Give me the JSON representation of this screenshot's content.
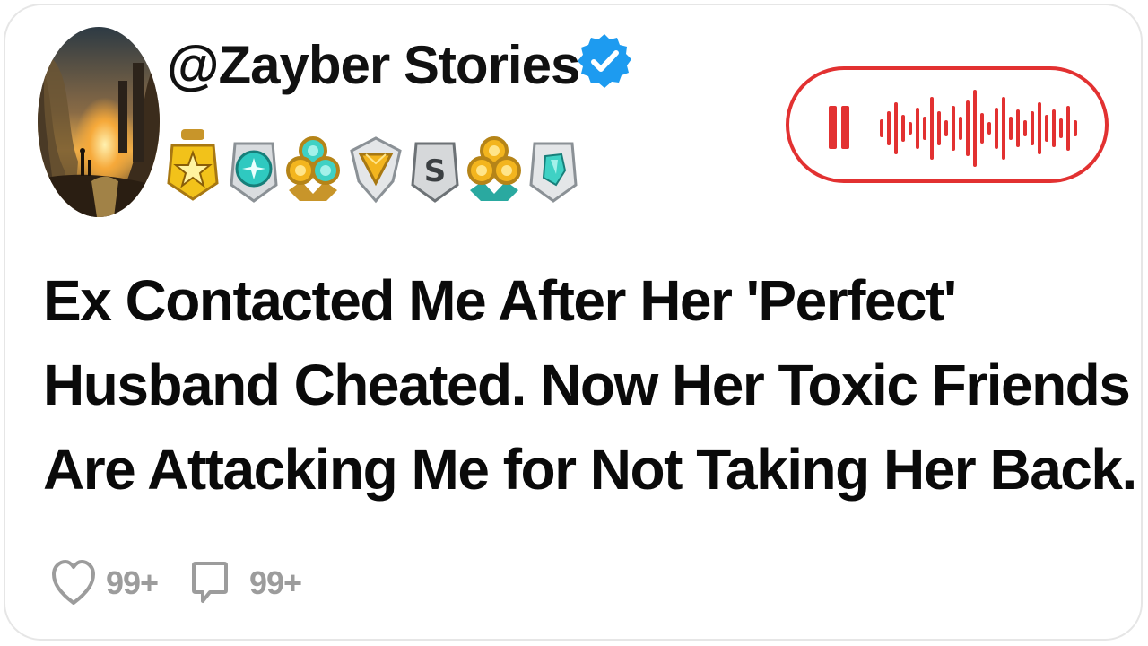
{
  "post": {
    "username": "@Zayber Stories",
    "verified": true,
    "title_lines": [
      "Ex Contacted Me After Her 'Perfect'",
      "Husband Cheated. Now Her Toxic Friends",
      "Are Attacking Me for Not Taking Her Back."
    ],
    "likes": "99+",
    "comments": "99+"
  },
  "badges": [
    {
      "name": "gold-star-badge-icon"
    },
    {
      "name": "silver-diamond-badge-icon"
    },
    {
      "name": "gold-trio-gem-badge-icon"
    },
    {
      "name": "silver-gold-gem-badge-icon"
    },
    {
      "name": "silver-s-badge-icon"
    },
    {
      "name": "gold-trio-gem-badge-icon-2"
    },
    {
      "name": "silver-crystal-badge-icon"
    }
  ],
  "colors": {
    "accent_red": "#e23131",
    "verified_blue": "#1d9bf0",
    "text": "#0a0a0a",
    "muted": "#9c9c9c"
  }
}
